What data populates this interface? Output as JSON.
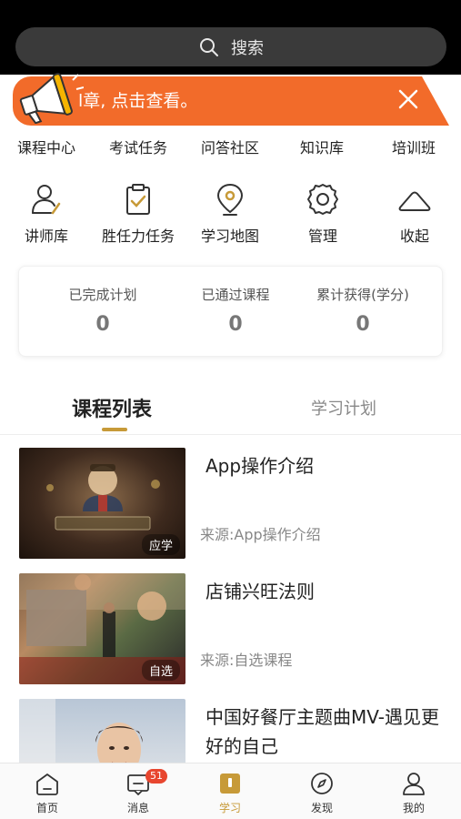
{
  "search": {
    "label": "搜索"
  },
  "notice": {
    "text": "l章, 点击查看。"
  },
  "links": [
    "课程中心",
    "考试任务",
    "问答社区",
    "知识库",
    "培训班"
  ],
  "icon_grid": [
    {
      "label": "讲师库",
      "icon": "lecturer-icon"
    },
    {
      "label": "胜任力任务",
      "icon": "clipboard-check-icon"
    },
    {
      "label": "学习地图",
      "icon": "map-pin-icon"
    },
    {
      "label": "管理",
      "icon": "gear-icon"
    },
    {
      "label": "收起",
      "icon": "collapse-icon"
    }
  ],
  "stats": [
    {
      "title": "已完成计划",
      "value": "0"
    },
    {
      "title": "已通过课程",
      "value": "0"
    },
    {
      "title": "累计获得(学分)",
      "value": "0"
    }
  ],
  "section_tabs": {
    "active": "课程列表",
    "inactive": "学习计划"
  },
  "courses": [
    {
      "title": "App操作介绍",
      "source": "来源:App操作介绍",
      "tag": "应学"
    },
    {
      "title": "店铺兴旺法则",
      "source": "来源:自选课程",
      "tag": "自选"
    },
    {
      "title": "中国好餐厅主题曲MV-遇见更好的自己",
      "source": "",
      "tag": ""
    }
  ],
  "bottom_nav": [
    {
      "label": "首页",
      "icon": "home-icon",
      "active": false
    },
    {
      "label": "消息",
      "icon": "message-icon",
      "active": false,
      "badge": "51"
    },
    {
      "label": "学习",
      "icon": "book-icon",
      "active": true
    },
    {
      "label": "发现",
      "icon": "compass-icon",
      "active": false
    },
    {
      "label": "我的",
      "icon": "profile-icon",
      "active": false
    }
  ],
  "colors": {
    "accent": "#c79a38",
    "notice": "#f26b2a",
    "badge": "#e8462f"
  }
}
